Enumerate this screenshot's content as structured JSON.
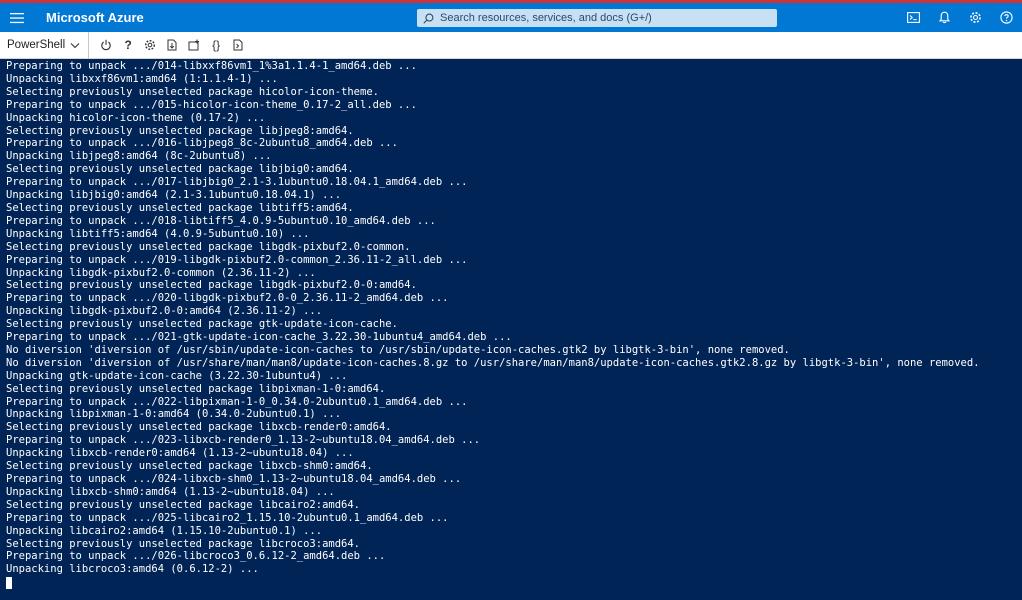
{
  "header": {
    "brand": "Microsoft Azure",
    "search_placeholder": "Search resources, services, and docs (G+/)",
    "icons": [
      "cloud-shell-icon",
      "bell-icon",
      "gear-icon",
      "help-icon"
    ]
  },
  "toolbar": {
    "shell": "PowerShell",
    "help_glyph": "?",
    "braces_glyph": "{}",
    "grip": "···"
  },
  "colors": {
    "top_strip": "#d13438",
    "header_bg": "#0078d4",
    "search_bg": "#c7e0f4",
    "terminal_bg": "#012456",
    "terminal_fg": "#ffffff"
  },
  "terminal": {
    "lines": [
      "Preparing to unpack .../014-libxxf86vm1_1%3a1.1.4-1_amd64.deb ...",
      "Unpacking libxxf86vm1:amd64 (1:1.1.4-1) ...",
      "Selecting previously unselected package hicolor-icon-theme.",
      "Preparing to unpack .../015-hicolor-icon-theme_0.17-2_all.deb ...",
      "Unpacking hicolor-icon-theme (0.17-2) ...",
      "Selecting previously unselected package libjpeg8:amd64.",
      "Preparing to unpack .../016-libjpeg8_8c-2ubuntu8_amd64.deb ...",
      "Unpacking libjpeg8:amd64 (8c-2ubuntu8) ...",
      "Selecting previously unselected package libjbig0:amd64.",
      "Preparing to unpack .../017-libjbig0_2.1-3.1ubuntu0.18.04.1_amd64.deb ...",
      "Unpacking libjbig0:amd64 (2.1-3.1ubuntu0.18.04.1) ...",
      "Selecting previously unselected package libtiff5:amd64.",
      "Preparing to unpack .../018-libtiff5_4.0.9-5ubuntu0.10_amd64.deb ...",
      "Unpacking libtiff5:amd64 (4.0.9-5ubuntu0.10) ...",
      "Selecting previously unselected package libgdk-pixbuf2.0-common.",
      "Preparing to unpack .../019-libgdk-pixbuf2.0-common_2.36.11-2_all.deb ...",
      "Unpacking libgdk-pixbuf2.0-common (2.36.11-2) ...",
      "Selecting previously unselected package libgdk-pixbuf2.0-0:amd64.",
      "Preparing to unpack .../020-libgdk-pixbuf2.0-0_2.36.11-2_amd64.deb ...",
      "Unpacking libgdk-pixbuf2.0-0:amd64 (2.36.11-2) ...",
      "Selecting previously unselected package gtk-update-icon-cache.",
      "Preparing to unpack .../021-gtk-update-icon-cache_3.22.30-1ubuntu4_amd64.deb ...",
      "No diversion 'diversion of /usr/sbin/update-icon-caches to /usr/sbin/update-icon-caches.gtk2 by libgtk-3-bin', none removed.",
      "No diversion 'diversion of /usr/share/man/man8/update-icon-caches.8.gz to /usr/share/man/man8/update-icon-caches.gtk2.8.gz by libgtk-3-bin', none removed.",
      "Unpacking gtk-update-icon-cache (3.22.30-1ubuntu4) ...",
      "Selecting previously unselected package libpixman-1-0:amd64.",
      "Preparing to unpack .../022-libpixman-1-0_0.34.0-2ubuntu0.1_amd64.deb ...",
      "Unpacking libpixman-1-0:amd64 (0.34.0-2ubuntu0.1) ...",
      "Selecting previously unselected package libxcb-render0:amd64.",
      "Preparing to unpack .../023-libxcb-render0_1.13-2~ubuntu18.04_amd64.deb ...",
      "Unpacking libxcb-render0:amd64 (1.13-2~ubuntu18.04) ...",
      "Selecting previously unselected package libxcb-shm0:amd64.",
      "Preparing to unpack .../024-libxcb-shm0_1.13-2~ubuntu18.04_amd64.deb ...",
      "Unpacking libxcb-shm0:amd64 (1.13-2~ubuntu18.04) ...",
      "Selecting previously unselected package libcairo2:amd64.",
      "Preparing to unpack .../025-libcairo2_1.15.10-2ubuntu0.1_amd64.deb ...",
      "Unpacking libcairo2:amd64 (1.15.10-2ubuntu0.1) ...",
      "Selecting previously unselected package libcroco3:amd64.",
      "Preparing to unpack .../026-libcroco3_0.6.12-2_amd64.deb ...",
      "Unpacking libcroco3:amd64 (0.6.12-2) ..."
    ]
  }
}
